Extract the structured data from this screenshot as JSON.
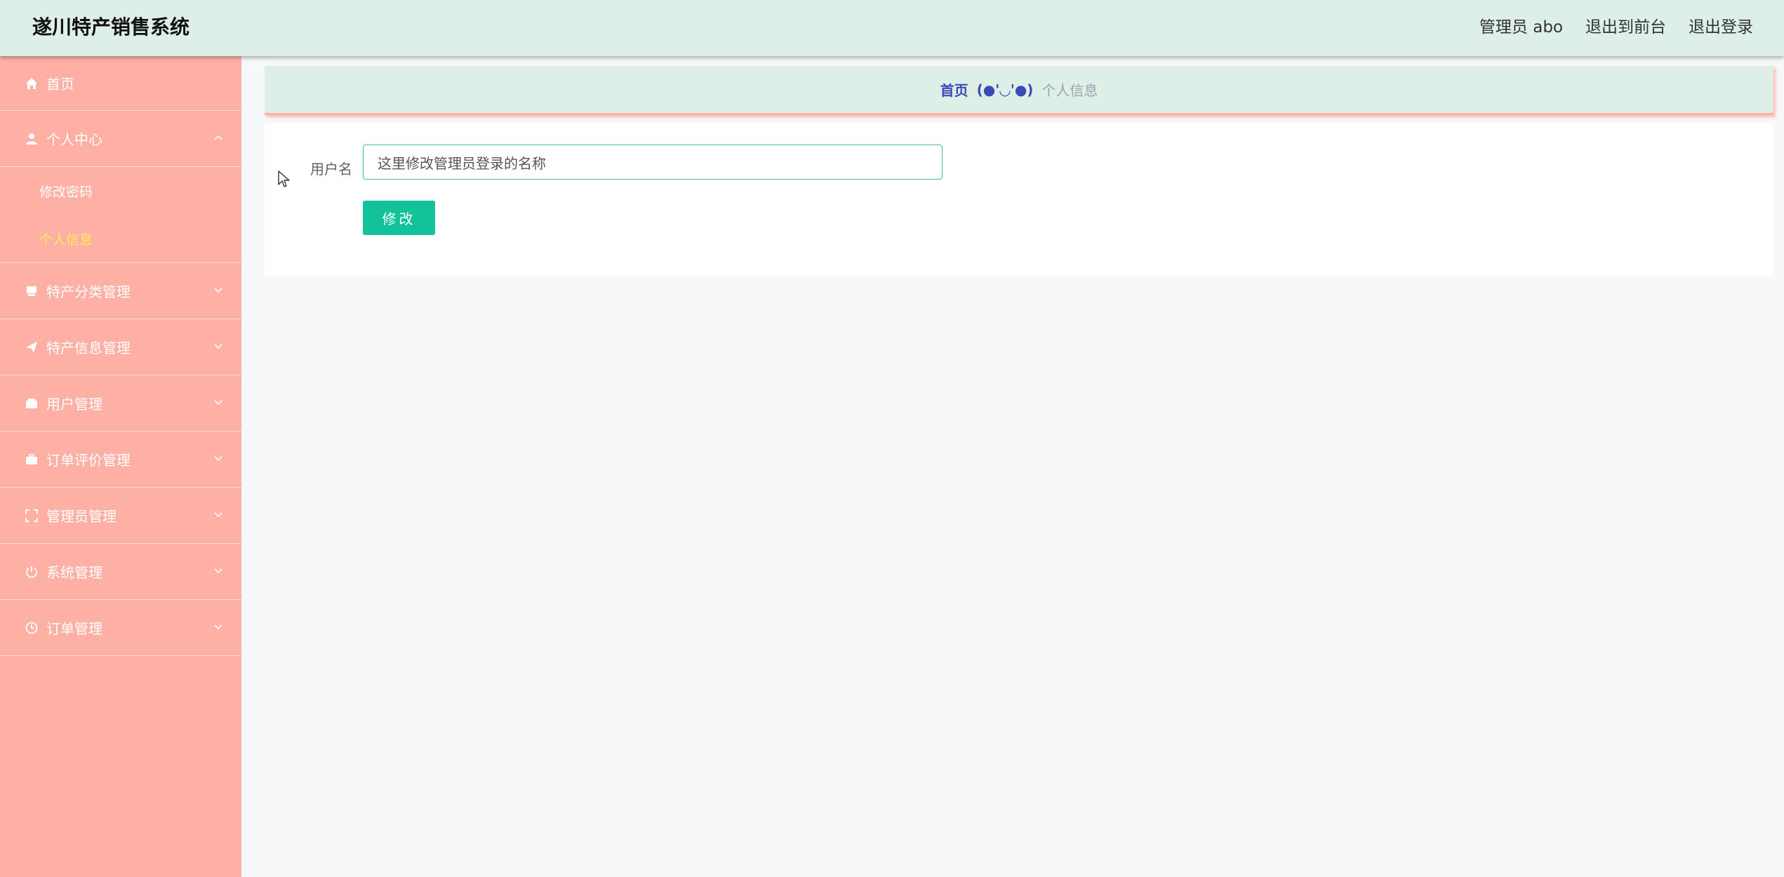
{
  "header": {
    "title": "遂川特产销售系统",
    "user_label": "管理员 abo",
    "to_front_label": "退出到前台",
    "logout_label": "退出登录"
  },
  "sidebar": {
    "items": [
      {
        "label": "首页",
        "icon": "home-icon"
      },
      {
        "label": "个人中心",
        "icon": "user-icon",
        "expanded": true,
        "children": [
          {
            "label": "修改密码"
          },
          {
            "label": "个人信息",
            "active": true
          }
        ]
      },
      {
        "label": "特产分类管理",
        "icon": "box-icon"
      },
      {
        "label": "特产信息管理",
        "icon": "send-icon"
      },
      {
        "label": "用户管理",
        "icon": "wallet-icon"
      },
      {
        "label": "订单评价管理",
        "icon": "briefcase-icon"
      },
      {
        "label": "管理员管理",
        "icon": "fullscreen-icon"
      },
      {
        "label": "系统管理",
        "icon": "power-icon"
      },
      {
        "label": "订单管理",
        "icon": "clock-icon"
      }
    ]
  },
  "breadcrumb": {
    "home": "首页",
    "separator": "(●'◡'●)",
    "current": "个人信息"
  },
  "form": {
    "username_label": "用户名",
    "username_value": "这里修改管理员登录的名称",
    "submit_label": "修改"
  },
  "colors": {
    "header_bg": "#deefe7",
    "sidebar_bg": "#ffb0a5",
    "active_text": "#ffee58",
    "button_bg": "#12c29a",
    "input_border": "#3dbbb0",
    "breadcrumb_home": "#3a4bb5"
  }
}
